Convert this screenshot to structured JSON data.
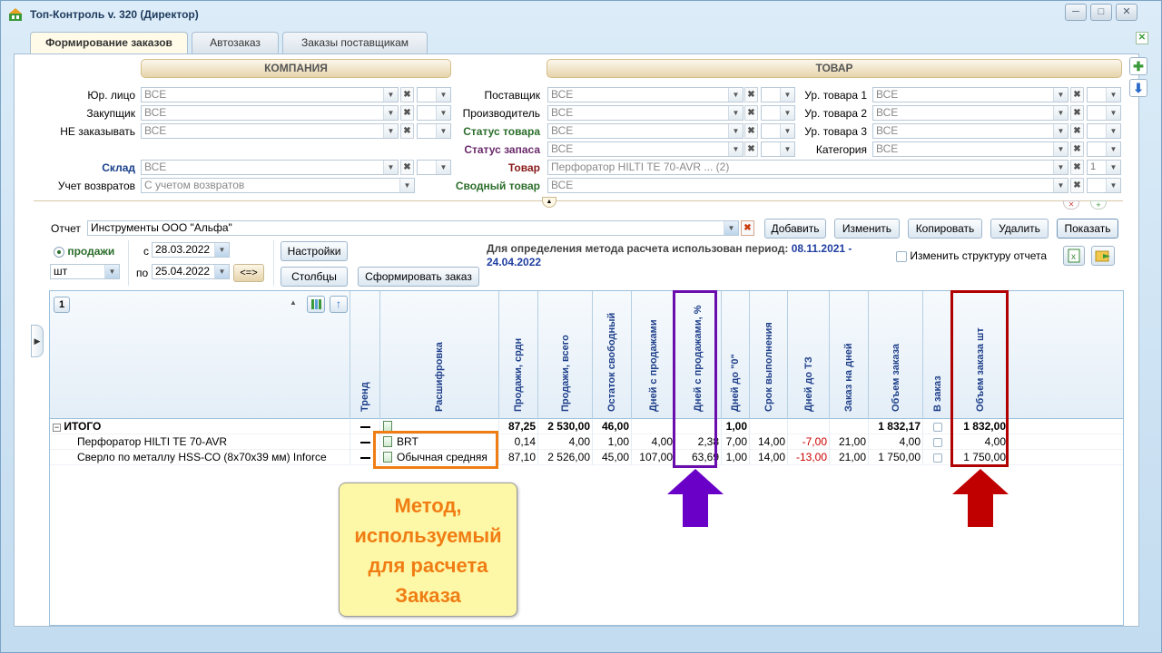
{
  "window": {
    "title": "Топ-Контроль v. 320 (Директор)",
    "minimize": "─",
    "maximize": "□",
    "close": "✕"
  },
  "tabs": [
    {
      "label": "Формирование заказов",
      "active": true
    },
    {
      "label": "Автозаказ",
      "active": false
    },
    {
      "label": "Заказы поставщикам",
      "active": false
    }
  ],
  "company_header": "КОМПАНИЯ",
  "product_header": "ТОВАР",
  "company_filters": {
    "legal": {
      "label": "Юр. лицо",
      "value": "ВСЕ"
    },
    "buyer": {
      "label": "Закупщик",
      "value": "ВСЕ"
    },
    "not_order": {
      "label": "НЕ заказывать",
      "value": "ВСЕ"
    },
    "warehouse": {
      "label": "Склад",
      "value": "ВСЕ"
    },
    "returns": {
      "label": "Учет возвратов",
      "value": "С учетом возвратов"
    }
  },
  "product_filters": {
    "supplier": {
      "label": "Поставщик",
      "value": "ВСЕ"
    },
    "manufacturer": {
      "label": "Производитель",
      "value": "ВСЕ"
    },
    "product_status": {
      "label": "Статус товара",
      "value": "ВСЕ"
    },
    "stock_status": {
      "label": "Статус запаса",
      "value": "ВСЕ"
    },
    "product": {
      "label": "Товар",
      "value": "Перфоратор HILTI TE 70-AVR ... (2)",
      "count": "1"
    },
    "summary_product": {
      "label": "Сводный товар",
      "value": "ВСЕ"
    },
    "level1": {
      "label": "Ур. товара 1",
      "value": "ВСЕ"
    },
    "level2": {
      "label": "Ур. товара 2",
      "value": "ВСЕ"
    },
    "level3": {
      "label": "Ур. товара 3",
      "value": "ВСЕ"
    },
    "category": {
      "label": "Категория",
      "value": "ВСЕ"
    }
  },
  "report": {
    "label": "Отчет",
    "value": "Инструменты ООО \"Альфа\"",
    "add": "Добавить",
    "edit": "Изменить",
    "copy": "Копировать",
    "delete": "Удалить",
    "show": "Показать"
  },
  "controls": {
    "sales_radio": "продажи",
    "unit": "шт",
    "from_label": "с",
    "from_date": "28.03.2022",
    "to_label": "по",
    "to_date": "25.04.2022",
    "swap": "<=>",
    "settings": "Настройки",
    "columns": "Столбцы",
    "form_order": "Сформировать заказ",
    "info_prefix": "Для определения метода расчета использован период:",
    "info_period": "08.11.2021 - 24.04.2022",
    "change_structure": "Изменить структуру отчета"
  },
  "grid": {
    "group_number": "1",
    "headers": [
      "Тренд",
      "Расшифровка",
      "Продажи, срдн",
      "Продажи, всего",
      "Остаток свободный",
      "Дней с продажами",
      "Дней с продажами, %",
      "Дней до \"0\"",
      "Срок выполнения",
      "Дней до ТЗ",
      "Заказ на дней",
      "Объем заказа",
      "В заказ",
      "Объем заказа шт"
    ],
    "total": {
      "name": "ИТОГО",
      "method": "",
      "sales_avg": "87,25",
      "sales_total": "2 530,00",
      "stock": "46,00",
      "days_sales": "",
      "days_sales_pct": "",
      "days_zero": "1,00",
      "lead": "",
      "days_tz": "",
      "order_days": "",
      "order_volume": "1 832,17",
      "order_qty": "1 832,00"
    },
    "rows": [
      {
        "name": "Перфоратор HILTI TE 70-AVR",
        "method": "BRT",
        "sales_avg": "0,14",
        "sales_total": "4,00",
        "stock": "1,00",
        "days_sales": "4,00",
        "days_sales_pct": "2,38",
        "days_zero": "7,00",
        "lead": "14,00",
        "days_tz": "-7,00",
        "order_days": "21,00",
        "order_volume": "4,00",
        "order_qty": "4,00"
      },
      {
        "name": "Сверло по металлу HSS-CO (8x70x39 мм) Inforce",
        "method": "Обычная средняя",
        "sales_avg": "87,10",
        "sales_total": "2 526,00",
        "stock": "45,00",
        "days_sales": "107,00",
        "days_sales_pct": "63,69",
        "days_zero": "1,00",
        "lead": "14,00",
        "days_tz": "-13,00",
        "order_days": "21,00",
        "order_volume": "1 750,00",
        "order_qty": "1 750,00"
      }
    ]
  },
  "callout": {
    "lines": [
      "Метод,",
      "используемый",
      "для расчета",
      "Заказа"
    ]
  },
  "colors": {
    "orange_box": "#f07d14",
    "purple_box": "#6a0dad",
    "red_box": "#b00000",
    "purple_arrow": "#6a00c8",
    "red_arrow": "#c00000"
  }
}
